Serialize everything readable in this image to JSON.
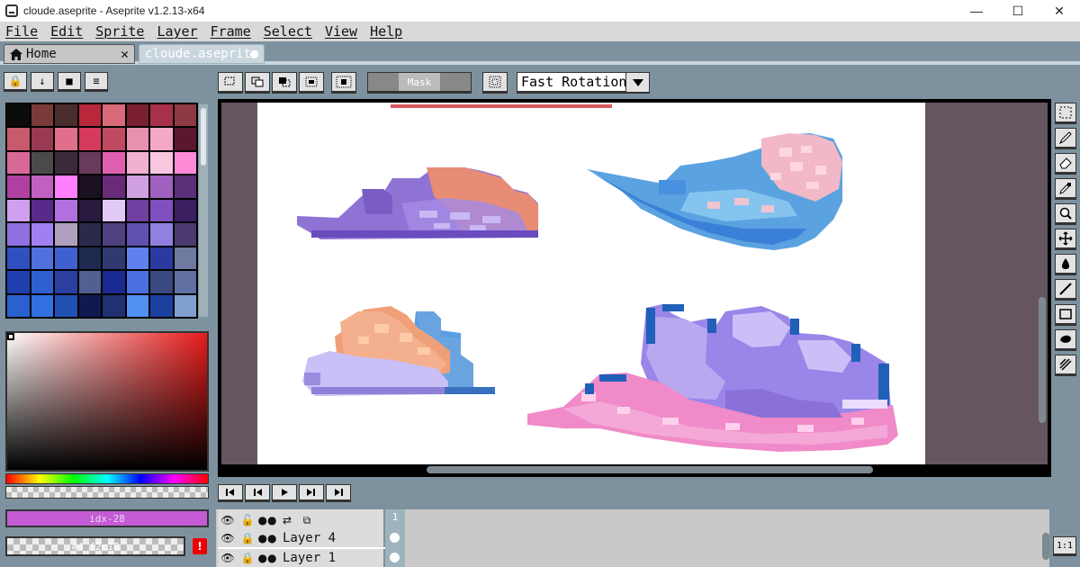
{
  "window": {
    "title": "cloude.aseprite - Aseprite v1.2.13-x64",
    "minimize": "—",
    "maximize": "☐",
    "close": "✕"
  },
  "menu": [
    "File",
    "Edit",
    "Sprite",
    "Layer",
    "Frame",
    "Select",
    "View",
    "Help"
  ],
  "tabs": {
    "home": "Home",
    "home_close": "✕",
    "file": "cloude.aseprite"
  },
  "palette_tools": [
    "🔒",
    "↓",
    "■",
    "≡"
  ],
  "palette": [
    "#0c0c0c",
    "#7a3a3a",
    "#4a2e2e",
    "#b8283a",
    "#d86a7a",
    "#7a2030",
    "#a83048",
    "#8e3a42",
    "#c85a6e",
    "#9a3a52",
    "#e0708a",
    "#d63a5c",
    "#c04a62",
    "#e890b0",
    "#f4a8c6",
    "#5a1830",
    "#d86896",
    "#4a4a4a",
    "#3a2a3a",
    "#6a3a5a",
    "#e060b0",
    "#f0b0d0",
    "#f8c8e0",
    "#ff8ad8",
    "#b040a0",
    "#c060c0",
    "#ff80ff",
    "#1a1020",
    "#6a2a7a",
    "#d0a0e0",
    "#a060c0",
    "#5a3078",
    "#d0a0f0",
    "#5a2a8a",
    "#b070e0",
    "#2a1a40",
    "#e0c8f8",
    "#7040a0",
    "#8050c0",
    "#3a2060",
    "#9070e0",
    "#a080f0",
    "#b0a0c0",
    "#2a2a4a",
    "#504080",
    "#6050b0",
    "#9080e0",
    "#4a3a70",
    "#3050c0",
    "#5070e0",
    "#4060d0",
    "#202a50",
    "#303a70",
    "#6080f0",
    "#2a3aa0",
    "#707aa0",
    "#2040b0",
    "#3060d0",
    "#2a40a0",
    "#506090",
    "#1a2a90",
    "#4a70e0",
    "#3a4a80",
    "#6070a0",
    "#2a60d0",
    "#3070e0",
    "#2050b0",
    "#101a50",
    "#203070",
    "#5090f0",
    "#1a40a0",
    "#80a0d0"
  ],
  "fg_color_label": "idx-28",
  "bg_color_label": "#4 f2c18",
  "context": {
    "mask_label": "Mask",
    "rotation_algorithm": "Fast Rotation"
  },
  "timeline": {
    "frame_number": "1",
    "layers": [
      "Layer 4",
      "Layer 1"
    ]
  },
  "zoom_label": "1:1"
}
